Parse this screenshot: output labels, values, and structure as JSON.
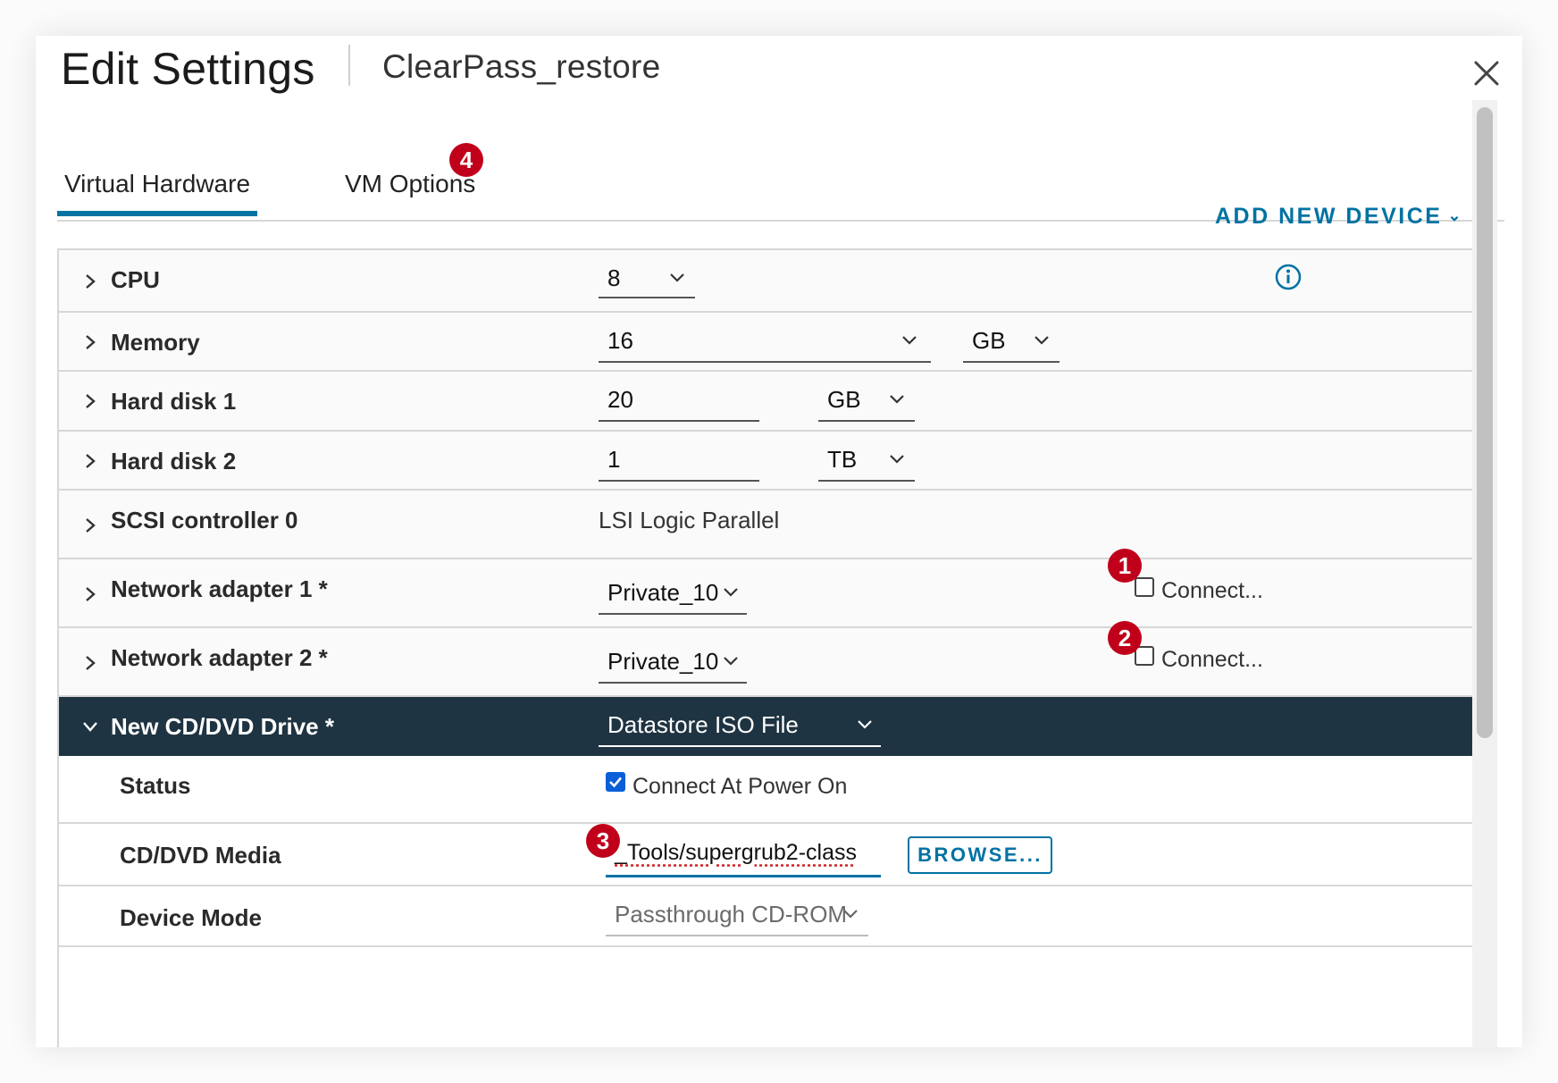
{
  "window": {
    "title": "Edit Settings",
    "vm_name": "ClearPass_restore"
  },
  "tabs": [
    {
      "label": "Virtual Hardware",
      "active": true
    },
    {
      "label": "VM Options",
      "active": false
    }
  ],
  "badges": [
    "1",
    "2",
    "3",
    "4"
  ],
  "add_device_label": "ADD NEW DEVICE",
  "icons": {
    "close": "close-icon",
    "info": "info-icon",
    "expand": "chevron-right-icon",
    "collapse": "chevron-down-icon",
    "dropdown": "chevron-down-icon"
  },
  "colors": {
    "accent": "#0072a3",
    "dark_row": "#1f3442",
    "badge": "#c0001a",
    "checkbox_checked": "#0a5fd8"
  },
  "devices": {
    "cpu": {
      "label": "CPU",
      "value": "8"
    },
    "memory": {
      "label": "Memory",
      "value": "16",
      "unit": "GB"
    },
    "hard_disk_1": {
      "label": "Hard disk 1",
      "value": "20",
      "unit": "GB"
    },
    "hard_disk_2": {
      "label": "Hard disk 2",
      "value": "1",
      "unit": "TB"
    },
    "scsi": {
      "label": "SCSI controller 0",
      "value": "LSI Logic Parallel"
    },
    "network_1": {
      "label": "Network adapter 1 *",
      "value": "Private_10",
      "connect_label": "Connect...",
      "connected": false
    },
    "network_2": {
      "label": "Network adapter 2 *",
      "value": "Private_10",
      "connect_label": "Connect...",
      "connected": false
    },
    "cd_dvd": {
      "label": "New CD/DVD Drive *",
      "value": "Datastore ISO File",
      "status": {
        "label": "Status",
        "checkbox_label": "Connect At Power On",
        "checked": true
      },
      "media": {
        "label": "CD/DVD Media",
        "value": "_Tools/supergrub2-class",
        "browse_label": "BROWSE..."
      },
      "device_mode": {
        "label": "Device Mode",
        "value": "Passthrough CD-ROM"
      }
    }
  }
}
